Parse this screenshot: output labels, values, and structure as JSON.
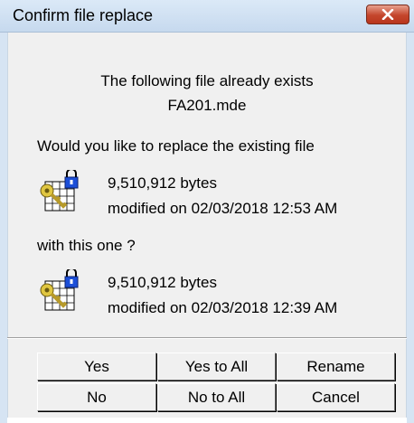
{
  "window": {
    "title": "Confirm file replace"
  },
  "message": {
    "line1": "The following file already exists",
    "filename": "FA201.mde",
    "question": "Would you like to replace the existing file",
    "with_label": "with this one ?"
  },
  "existing_file": {
    "size": "9,510,912 bytes",
    "modified": "modified on 02/03/2018 12:53 AM",
    "icon": "locked-database-icon"
  },
  "new_file": {
    "size": "9,510,912 bytes",
    "modified": "modified on 02/03/2018 12:39 AM",
    "icon": "locked-database-icon"
  },
  "buttons": {
    "yes": "Yes",
    "yes_to_all": "Yes to All",
    "rename": "Rename",
    "no": "No",
    "no_to_all": "No to All",
    "cancel": "Cancel"
  },
  "colors": {
    "titlebar": "#c6d9ee",
    "close_button": "#c4462c",
    "dialog_background": "#f0f0f0"
  }
}
